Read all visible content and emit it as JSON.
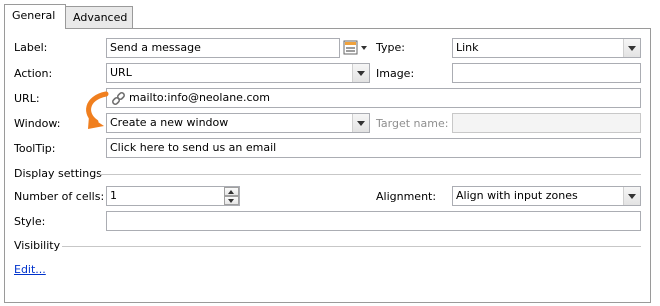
{
  "tabs": [
    {
      "label": "General",
      "active": true
    },
    {
      "label": "Advanced",
      "active": false
    }
  ],
  "form": {
    "label_label": "Label:",
    "label_value": "Send a message",
    "type_label": "Type:",
    "type_value": "Link",
    "action_label": "Action:",
    "action_value": "URL",
    "image_label": "Image:",
    "image_value": "",
    "url_label": "URL:",
    "url_value": "mailto:info@neolane.com",
    "window_label": "Window:",
    "window_value": "Create a new window",
    "target_label": "Target name:",
    "target_value": "",
    "tooltip_label": "ToolTip:",
    "tooltip_value": "Click here to send us an email"
  },
  "display_settings": {
    "heading": "Display settings",
    "cells_label": "Number of cells:",
    "cells_value": "1",
    "alignment_label": "Alignment:",
    "alignment_value": "Align with input zones",
    "style_label": "Style:",
    "style_value": ""
  },
  "visibility": {
    "heading": "Visibility",
    "edit_link": "Edit..."
  },
  "icons": {
    "label_picker": "text-format-icon",
    "url": "link-icon",
    "annotation": "orange-curved-arrow-icon"
  },
  "colors": {
    "accent_arrow": "#f07f1f",
    "link": "#0033cc"
  }
}
